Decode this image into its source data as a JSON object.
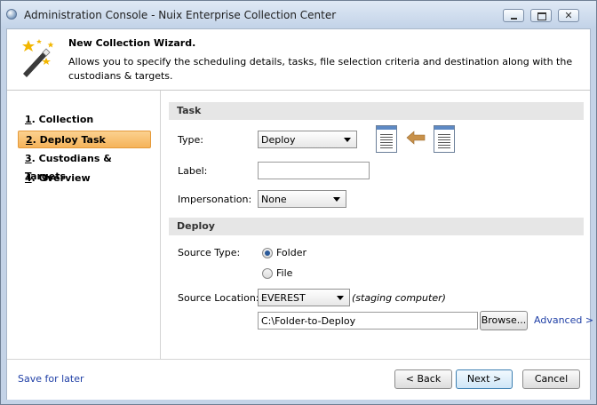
{
  "window": {
    "title": "Administration Console - Nuix Enterprise Collection Center"
  },
  "header": {
    "title": "New Collection Wizard.",
    "description": "Allows you to specify the scheduling details, tasks, file selection criteria and destination along with the custodians & targets.",
    "icon": "magic-wand-icon"
  },
  "nav": {
    "items": [
      {
        "num": "1",
        "label": ". Collection",
        "active": false
      },
      {
        "num": "2",
        "label": ". Deploy Task",
        "active": true
      },
      {
        "num": "3",
        "label": ". Custodians & Targets",
        "active": false
      },
      {
        "num": "4",
        "label": ". Overview",
        "active": false
      }
    ]
  },
  "task": {
    "section_title": "Task",
    "type_label": "Type:",
    "type_value": "Deploy",
    "label_label": "Label:",
    "label_value": "",
    "impersonation_label": "Impersonation:",
    "impersonation_value": "None"
  },
  "deploy": {
    "section_title": "Deploy",
    "source_type_label": "Source Type:",
    "option_folder": "Folder",
    "option_file": "File",
    "selected": "Folder",
    "source_location_label": "Source Location:",
    "source_location_value": "EVEREST",
    "staging_note": "(staging computer)",
    "path_value": "C:\\Folder-to-Deploy",
    "browse_label": "Browse...",
    "advanced_label": "Advanced >"
  },
  "footer": {
    "save_label": "Save for later",
    "back_label": "< Back",
    "next_label": "Next >",
    "cancel_label": "Cancel"
  },
  "colors": {
    "active_nav": "#f5b35a",
    "link": "#1f3fa6",
    "section_bg": "#e6e6e6"
  }
}
